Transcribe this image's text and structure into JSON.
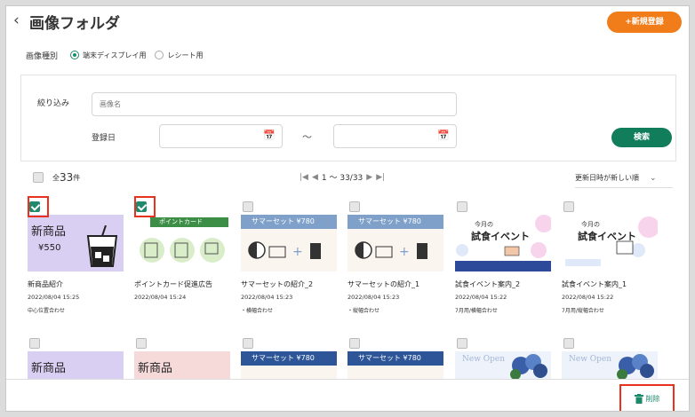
{
  "header": {
    "back_icon": "chevron-left-icon",
    "title": "画像フォルダ",
    "new_button": "+新規登録"
  },
  "image_type": {
    "label": "画像種別",
    "options": [
      {
        "label": "端末ディスプレイ用",
        "selected": true
      },
      {
        "label": "レシート用",
        "selected": false
      }
    ]
  },
  "filter": {
    "narrow_label": "絞り込み",
    "name_placeholder": "画像名",
    "date_label": "登録日",
    "range_separator": "〜",
    "search_button": "検索"
  },
  "list": {
    "total_prefix": "全",
    "total_count": "33",
    "total_suffix": "件",
    "pagination": "1 〜 33/33",
    "sort": "更新日時が新しい順"
  },
  "items": [
    {
      "name": "新商品紹介",
      "date": "2022/08/04 15:25",
      "tag": "中心位置合わせ",
      "checked": true,
      "thumb_title": "新商品",
      "thumb_price": "¥550"
    },
    {
      "name": "ポイントカード促進広告",
      "date": "2022/08/04 15:24",
      "tag": "",
      "checked": true,
      "thumb_title": "ポイントカード"
    },
    {
      "name": "サマーセットの紹介_2",
      "date": "2022/08/04 15:23",
      "tag": "・横幅合わせ",
      "checked": false,
      "thumb_title": "サマーセット ¥780"
    },
    {
      "name": "サマーセットの紹介_1",
      "date": "2022/08/04 15:23",
      "tag": "・縦幅合わせ",
      "checked": false,
      "thumb_title": "サマーセット ¥780"
    },
    {
      "name": "試食イベント案内_2",
      "date": "2022/08/04 15:22",
      "tag": "7月用/横幅合わせ",
      "checked": false,
      "thumb_sub": "今月の",
      "thumb_title": "試食イベント"
    },
    {
      "name": "試食イベント案内_1",
      "date": "2022/08/04 15:22",
      "tag": "7月用/縦幅合わせ",
      "checked": false,
      "thumb_sub": "今月の",
      "thumb_title": "試食イベント"
    }
  ],
  "row2": [
    {
      "thumb_title": "新商品"
    },
    {
      "thumb_title": "新商品"
    },
    {
      "thumb_title": "サマーセット ¥780"
    },
    {
      "thumb_title": "サマーセット ¥780"
    },
    {
      "thumb_title": "New Open"
    },
    {
      "thumb_title": "New Open"
    }
  ],
  "footer": {
    "delete_button": "削除"
  },
  "colors": {
    "accent_orange": "#f07d1a",
    "primary_green": "#127d5b",
    "highlight_red": "#e8321e"
  }
}
